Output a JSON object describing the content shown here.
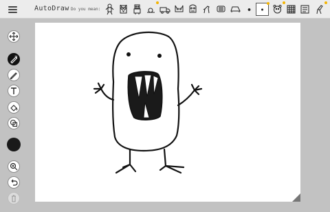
{
  "header": {
    "menu_icon": "hamburger-menu-icon",
    "app_title": "AutoDraw",
    "suggestions_label": "Do you mean:",
    "suggestions": [
      {
        "icon": "gingerbread-man-icon"
      },
      {
        "icon": "owl-icon"
      },
      {
        "icon": "robot-icon"
      },
      {
        "icon": "snail-icon"
      },
      {
        "icon": "truck-icon"
      },
      {
        "icon": "cat-face-icon"
      },
      {
        "icon": "monster-face-icon"
      },
      {
        "icon": "horse-icon"
      },
      {
        "icon": "crab-icon"
      },
      {
        "icon": "bus-icon"
      },
      {
        "icon": "boat-icon"
      },
      {
        "icon": "ladybug-icon"
      },
      {
        "icon": "selected-shape-icon"
      },
      {
        "icon": "bear-icon"
      },
      {
        "icon": "pattern-icon"
      },
      {
        "icon": "card-icon"
      },
      {
        "icon": "giraffe-icon"
      }
    ]
  },
  "tools": {
    "move": "move-arrows-icon",
    "autodraw": "autodraw-pen-icon",
    "draw": "pencil-icon",
    "type": "text-T-icon",
    "fill": "fill-bucket-icon",
    "shape": "shapes-icon",
    "color": "#1a1a1a",
    "zoom": "zoom-icon",
    "undo": "undo-icon",
    "delete": "trash-icon"
  },
  "colors": {
    "topbar": "#ececec",
    "workspace": "#c2c2c2",
    "canvas": "#ffffff",
    "accent_dot": "#f4b400"
  }
}
